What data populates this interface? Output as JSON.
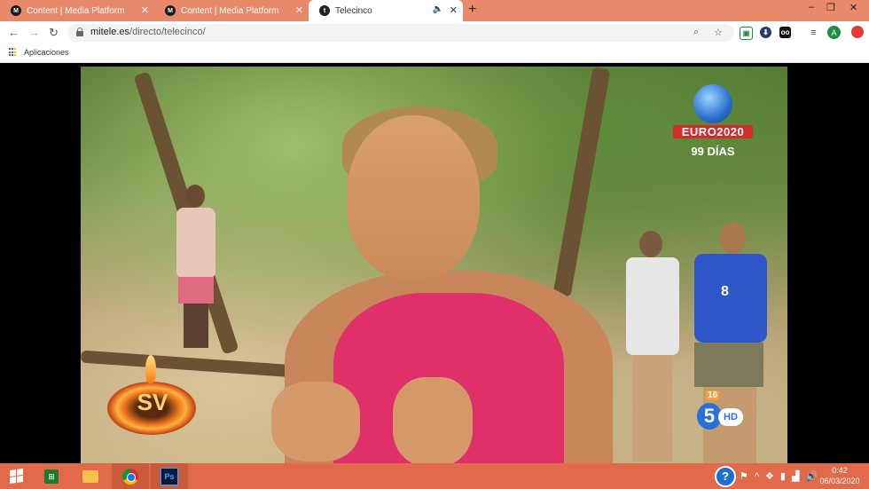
{
  "browser": {
    "tabs": [
      {
        "favicon": "M",
        "title": "Content | Media Platform",
        "active": false
      },
      {
        "favicon": "M",
        "title": "Content | Media Platform",
        "active": false
      },
      {
        "favicon": "t",
        "title": "Telecinco",
        "active": true
      }
    ],
    "new_tab": "+",
    "window_controls": {
      "minimize": "–",
      "restore": "❐",
      "close": "✕"
    },
    "url_host": "mitele.es",
    "url_path": "/directo/telecinco/",
    "bookmarks": [
      {
        "label": "Aplicaciones",
        "icon": "apps-grid-icon"
      }
    ],
    "profile_initial": "A",
    "extensions": [
      "extension-green-icon",
      "extension-shield-icon",
      "extension-glasses-icon",
      "media-icon"
    ]
  },
  "video": {
    "overlay_euro": {
      "logo": "EURO2020",
      "countdown": "99 DÍAS"
    },
    "show_logo": "SV",
    "channel": {
      "age_rating": "16",
      "number": "5",
      "quality": "HD"
    },
    "jersey_number": "8"
  },
  "taskbar": {
    "apps": [
      {
        "name": "windows-start-icon"
      },
      {
        "name": "store-icon"
      },
      {
        "name": "file-explorer-icon"
      },
      {
        "name": "chrome-icon"
      },
      {
        "name": "photoshop-icon",
        "label": "Ps"
      }
    ],
    "store_label": "⊞",
    "help": "?",
    "clock": {
      "time": "0:42",
      "date": "06/03/2020"
    }
  },
  "colors": {
    "tab_strip": "#e8896a",
    "taskbar": "#e06a4a",
    "accent_blue": "#1a73e8"
  }
}
